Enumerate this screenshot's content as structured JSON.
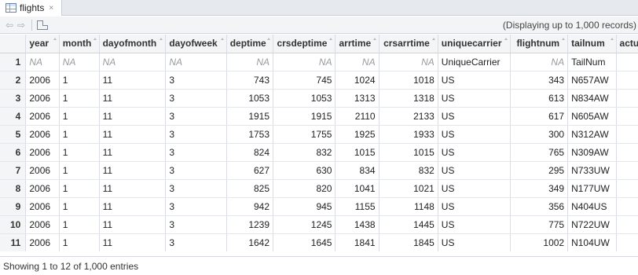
{
  "tab": {
    "title": "flights",
    "close": "×"
  },
  "toolbar": {
    "back": "⇦",
    "forward": "⇨",
    "display_note": "(Displaying up to 1,000 records)"
  },
  "columns": [
    {
      "key": "rn",
      "label": ""
    },
    {
      "key": "year",
      "label": "year"
    },
    {
      "key": "month",
      "label": "month"
    },
    {
      "key": "dayofmonth",
      "label": "dayofmonth"
    },
    {
      "key": "dayofweek",
      "label": "dayofweek"
    },
    {
      "key": "deptime",
      "label": "deptime"
    },
    {
      "key": "crsdeptime",
      "label": "crsdeptime"
    },
    {
      "key": "arrtime",
      "label": "arrtime"
    },
    {
      "key": "crsarrtime",
      "label": "crsarrtime"
    },
    {
      "key": "uniquecarrier",
      "label": "uniquecarrier"
    },
    {
      "key": "flightnum",
      "label": "flightnum"
    },
    {
      "key": "tailnum",
      "label": "tailnum"
    },
    {
      "key": "actualelapsedtime",
      "label": "actualelapse"
    }
  ],
  "rows": [
    [
      "1",
      "NA",
      "NA",
      "NA",
      "NA",
      "NA",
      "NA",
      "NA",
      "NA",
      "UniqueCarrier",
      "NA",
      "TailNum",
      ""
    ],
    [
      "2",
      "2006",
      "1",
      "11",
      "3",
      "743",
      "745",
      "1024",
      "1018",
      "US",
      "343",
      "N657AW",
      ""
    ],
    [
      "3",
      "2006",
      "1",
      "11",
      "3",
      "1053",
      "1053",
      "1313",
      "1318",
      "US",
      "613",
      "N834AW",
      ""
    ],
    [
      "4",
      "2006",
      "1",
      "11",
      "3",
      "1915",
      "1915",
      "2110",
      "2133",
      "US",
      "617",
      "N605AW",
      ""
    ],
    [
      "5",
      "2006",
      "1",
      "11",
      "3",
      "1753",
      "1755",
      "1925",
      "1933",
      "US",
      "300",
      "N312AW",
      ""
    ],
    [
      "6",
      "2006",
      "1",
      "11",
      "3",
      "824",
      "832",
      "1015",
      "1015",
      "US",
      "765",
      "N309AW",
      ""
    ],
    [
      "7",
      "2006",
      "1",
      "11",
      "3",
      "627",
      "630",
      "834",
      "832",
      "US",
      "295",
      "N733UW",
      ""
    ],
    [
      "8",
      "2006",
      "1",
      "11",
      "3",
      "825",
      "820",
      "1041",
      "1021",
      "US",
      "349",
      "N177UW",
      ""
    ],
    [
      "9",
      "2006",
      "1",
      "11",
      "3",
      "942",
      "945",
      "1155",
      "1148",
      "US",
      "356",
      "N404US",
      ""
    ],
    [
      "10",
      "2006",
      "1",
      "11",
      "3",
      "1239",
      "1245",
      "1438",
      "1445",
      "US",
      "775",
      "N722UW",
      ""
    ],
    [
      "11",
      "2006",
      "1",
      "11",
      "3",
      "1642",
      "1645",
      "1841",
      "1845",
      "US",
      "1002",
      "N104UW",
      ""
    ]
  ],
  "footer": {
    "entries_text": "Showing 1 to 12 of 1,000 entries"
  }
}
